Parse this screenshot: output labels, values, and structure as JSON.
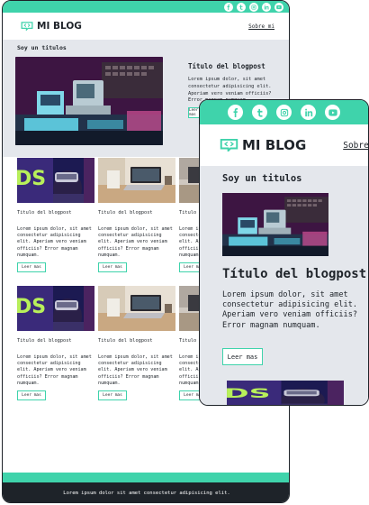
{
  "brand": {
    "name": "MI BLOG",
    "accent": "#3fd3ab",
    "dark": "#1e2329",
    "panel": "#e4e7ec"
  },
  "social_icons": [
    "facebook-icon",
    "twitter-icon",
    "instagram-icon",
    "linkedin-icon",
    "youtube-icon"
  ],
  "nav": {
    "about_link": "Sobre mi"
  },
  "featured": {
    "section_title": "Soy un titulos",
    "post_title": "Título del blogpost",
    "excerpt": "Lorem ipsum dolor, sit amet consectetur adipisicing elit. Aperiam vero veniam officiis? Error magnam numquam.",
    "button": "Leer mas"
  },
  "cards": {
    "title": "Titulo del blogpost",
    "excerpt": "Lorem ipsum dolor, sit amet consectetur adipisicing elit. Aperiam vero veniam officiis? Error magnam numquam.",
    "button": "Leer mas"
  },
  "footer": {
    "text": "Lorem ipsum dolor sit amet consectetur adipisicing elit."
  }
}
